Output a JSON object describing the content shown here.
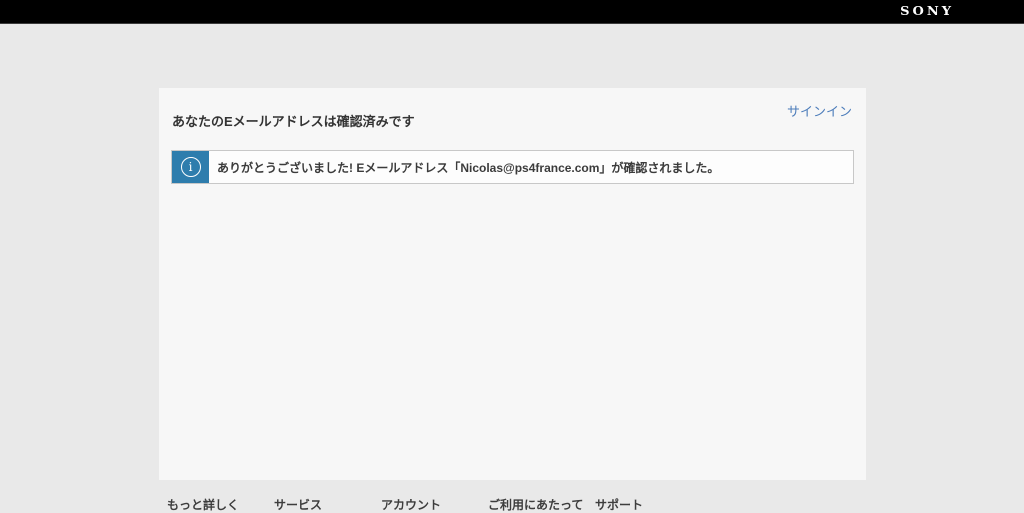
{
  "header": {
    "brand": "SONY"
  },
  "card": {
    "signin_label": "サインイン",
    "title": "あなたのEメールアドレスは確認済みです",
    "notice": {
      "icon": "info-icon",
      "icon_glyph": "i",
      "message": "ありがとうございました! Eメールアドレス「Nicolas@ps4france.com」が確認されました。"
    }
  },
  "footer": {
    "links": [
      {
        "label": "もっと詳しく"
      },
      {
        "label": "サービス"
      },
      {
        "label": "アカウント"
      },
      {
        "label": "ご利用にあたって"
      },
      {
        "label": "サポート"
      }
    ]
  },
  "colors": {
    "header_bg": "#000000",
    "page_bg": "#e9e9e9",
    "card_bg": "#f7f7f7",
    "notice_accent_blue": "#2e7dad",
    "notice_border": "#c8c8c8",
    "link_blue": "#4c7cba",
    "text_dark": "#333333"
  }
}
